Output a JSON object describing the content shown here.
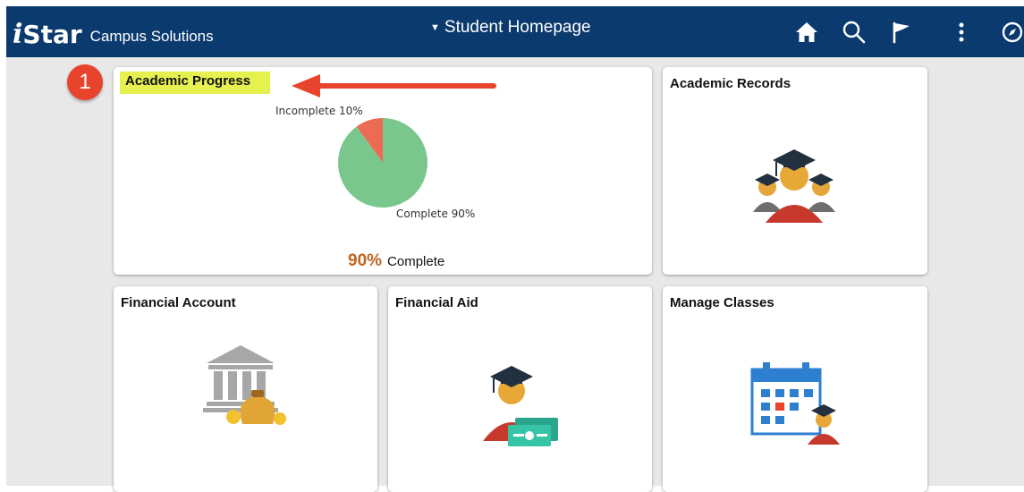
{
  "header": {
    "logo_i": "i",
    "logo_star": "Star",
    "logo_subtitle": "Campus Solutions",
    "page_title": "Student Homepage",
    "page_title_caret": "▼",
    "icons": [
      "home-icon",
      "search-icon",
      "flag-icon",
      "more-vertical-icon",
      "navbar-compass-icon"
    ]
  },
  "annotation": {
    "step_number": "1"
  },
  "tiles": {
    "academic_progress": {
      "title": "Academic Progress",
      "chart_data": {
        "type": "pie",
        "slices": [
          {
            "label": "Incomplete 10%",
            "value": 10,
            "color": "#ec6b55"
          },
          {
            "label": "Complete 90%",
            "value": 90,
            "color": "#79c78c"
          }
        ]
      },
      "percent": "90%",
      "percent_label": "Complete"
    },
    "academic_records": {
      "title": "Academic Records",
      "icon": "graduates-group-icon"
    },
    "financial_account": {
      "title": "Financial Account",
      "icon": "bank-money-icon"
    },
    "financial_aid": {
      "title": "Financial Aid",
      "icon": "graduate-cash-icon"
    },
    "manage_classes": {
      "title": "Manage Classes",
      "icon": "calendar-student-icon"
    }
  },
  "colors": {
    "header_bg": "#0b3a6e",
    "content_bg": "#e8e8e8",
    "highlight": "#e6f04f",
    "badge": "#e8432c",
    "percent_text": "#c0651f"
  }
}
